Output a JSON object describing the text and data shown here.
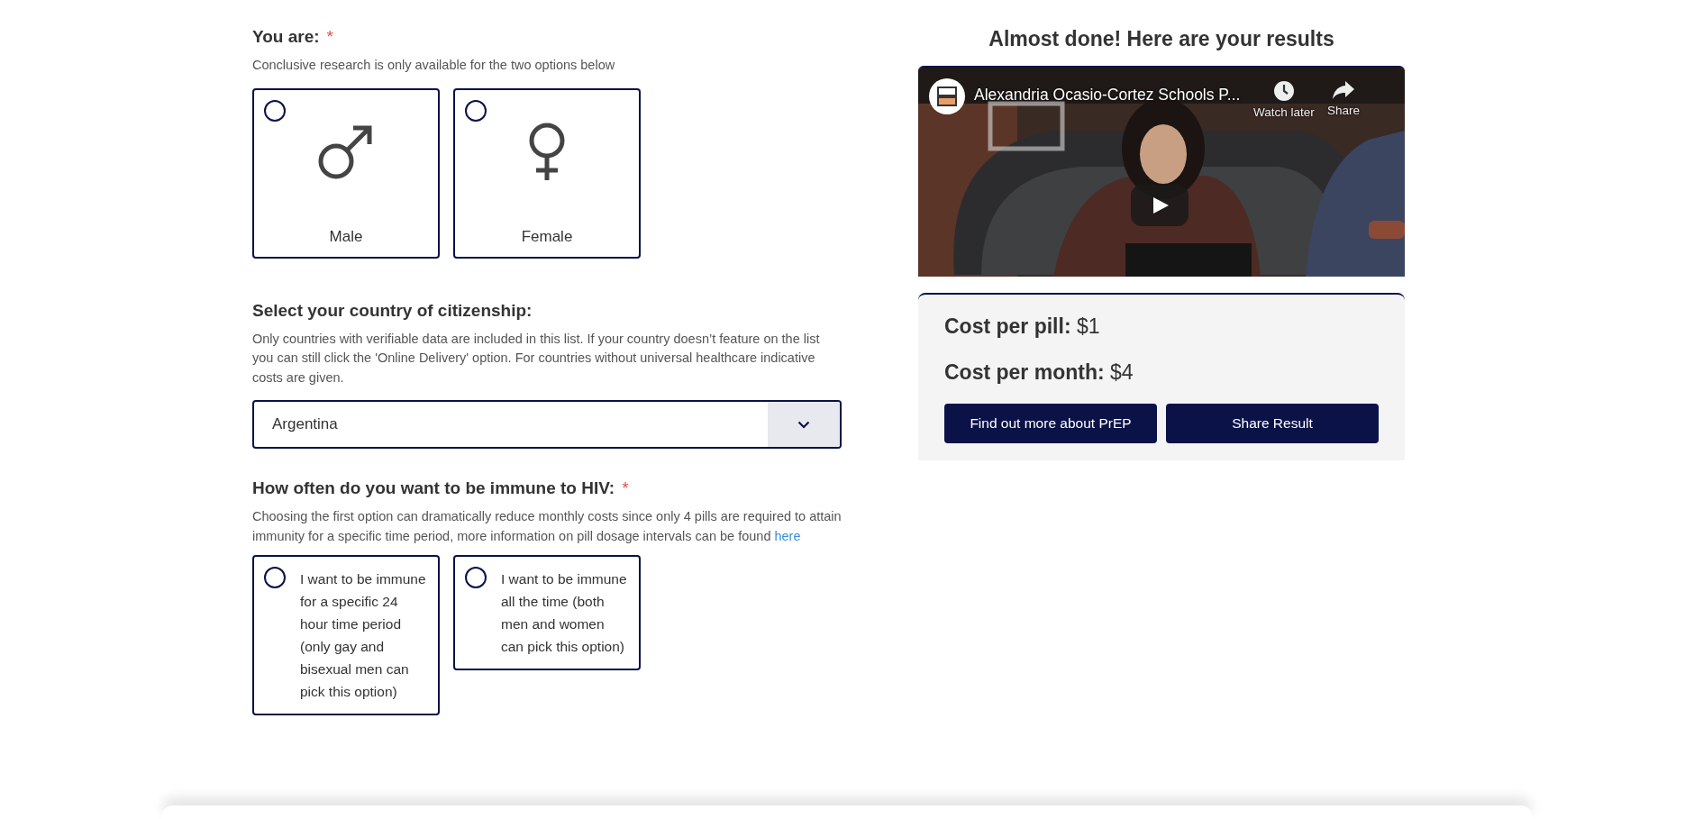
{
  "gender_question": {
    "label": "You are:",
    "required_mark": "*",
    "hint": "Conclusive research is only available for the two options below",
    "options": [
      {
        "label": "Male",
        "kind": "male",
        "selected": false
      },
      {
        "label": "Female",
        "kind": "female",
        "selected": false
      }
    ]
  },
  "country_question": {
    "label": "Select your country of citizenship:",
    "hint": "Only countries with verifiable data are included in this list. If your country doesn’t feature on the list you can still click the 'Online Delivery' option. For countries without universal healthcare indicative costs are given.",
    "value": "Argentina"
  },
  "frequency_question": {
    "label": "How often do you want to be immune to HIV:",
    "required_mark": "*",
    "hint": "Choosing the first option can dramatically reduce monthly costs since only 4 pills are required to attain immunity for a specific time period, more information on pill dosage intervals can be found",
    "link": "here",
    "options": [
      {
        "label": "I want to be immune for a specific 24 hour time period (only gay and bisexual men can pick this option)",
        "selected": false
      },
      {
        "label": "I want to be immune all the time (both men and women can pick this option)",
        "selected": false
      }
    ]
  },
  "results": {
    "title": "Almost done! Here are your results",
    "video": {
      "kind": "picture",
      "title": "Alexandria Ocasio-Cortez Schools P...",
      "actions": [
        {
          "label": "Watch later",
          "kind": "clock"
        },
        {
          "label": "Share",
          "kind": "share"
        }
      ]
    },
    "costs": [
      {
        "label": "Cost per pill:",
        "value": "$1"
      },
      {
        "label": "Cost per month:",
        "value": "$4"
      }
    ],
    "buttons": [
      "Find out more about PrEP",
      "Share Result"
    ]
  }
}
